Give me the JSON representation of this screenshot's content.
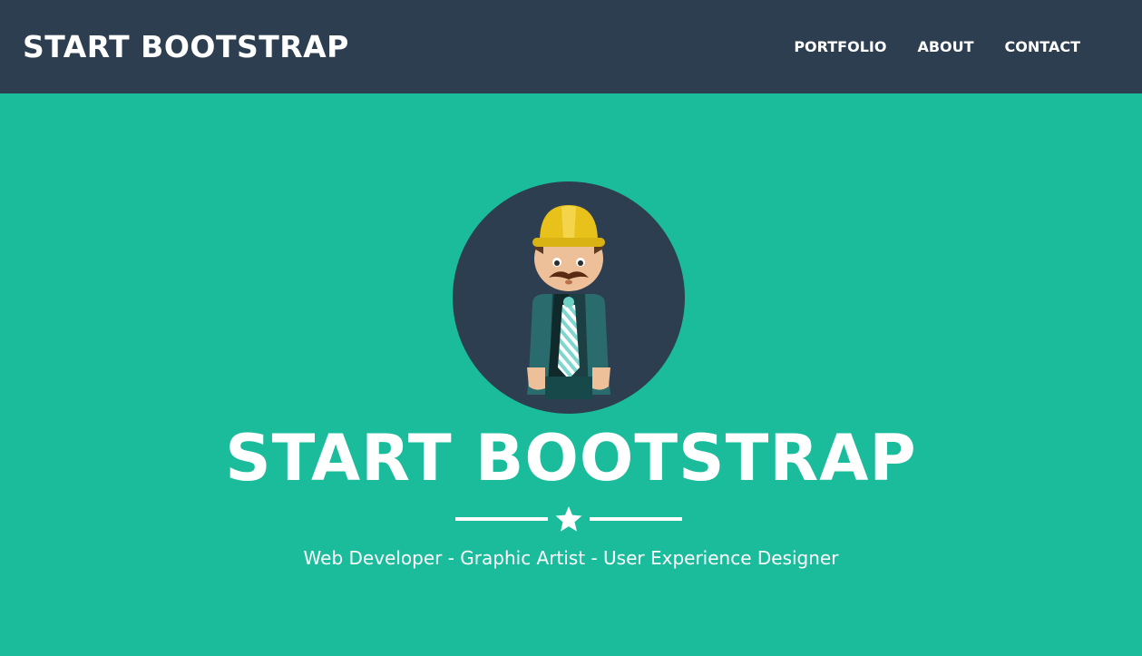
{
  "navbar": {
    "brand": "START BOOTSTRAP",
    "links": [
      "PORTFOLIO",
      "ABOUT",
      "CONTACT"
    ]
  },
  "masthead": {
    "title": "START BOOTSTRAP",
    "subtitle": "Web Developer - Graphic Artist - User Experience Designer",
    "avatar_icon": "construction-worker-avatar",
    "divider_icon": "star-icon"
  },
  "colors": {
    "navbar_bg": "#2c3e50",
    "primary": "#1abc9c",
    "text": "#ffffff",
    "avatar_bg": "#2c3e50",
    "helmet": "#e8c21a"
  }
}
